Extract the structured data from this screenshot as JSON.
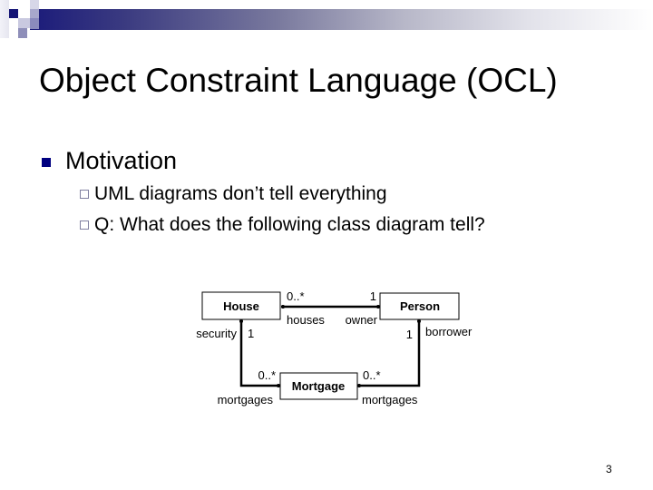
{
  "slide": {
    "title": "Object Constraint Language (OCL)",
    "bullets": [
      {
        "text": "Motivation",
        "sub": [
          "UML diagrams don’t tell everything",
          "Q: What does the following class diagram tell?"
        ]
      }
    ],
    "page_number": "3",
    "accent_color": "#000080"
  },
  "diagram": {
    "classes": {
      "house": "House",
      "person": "Person",
      "mortgage": "Mortgage"
    },
    "associations": {
      "house_person": {
        "house_mult": "0..*",
        "house_role": "houses",
        "person_mult": "1",
        "person_role": "owner"
      },
      "house_mortgage": {
        "house_mult": "1",
        "house_role": "security",
        "mortgage_mult": "0..*",
        "mortgage_role": "mortgages"
      },
      "person_mortgage": {
        "person_mult": "1",
        "person_role": "borrower",
        "mortgage_mult": "0..*",
        "mortgage_role": "mortgages"
      }
    }
  }
}
